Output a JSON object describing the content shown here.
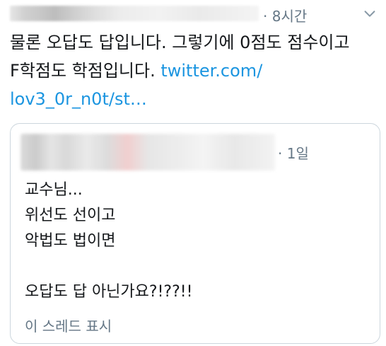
{
  "tweet": {
    "time_meta": "· 8시간",
    "text_lines": [
      "물론 오답도 답입니다. 그렇기에 0점도 점수이고"
    ],
    "text_line2_prefix": "F학점도 학점입니다. ",
    "link_part1": "twitter.com/",
    "link_part2": "lov3_0r_n0t/st…"
  },
  "quote": {
    "time_meta": "· 1일",
    "lines": [
      "교수님...",
      "위선도 선이고",
      "악법도 법이면",
      "",
      "오답도 답 아닌가요?!??!!"
    ],
    "thread_link": "이 스레드 표시"
  },
  "colors": {
    "link": "#1b95e0",
    "meta": "#657786",
    "border": "#ccd6dd"
  },
  "icons": {
    "menu": "chevron-down-icon"
  }
}
